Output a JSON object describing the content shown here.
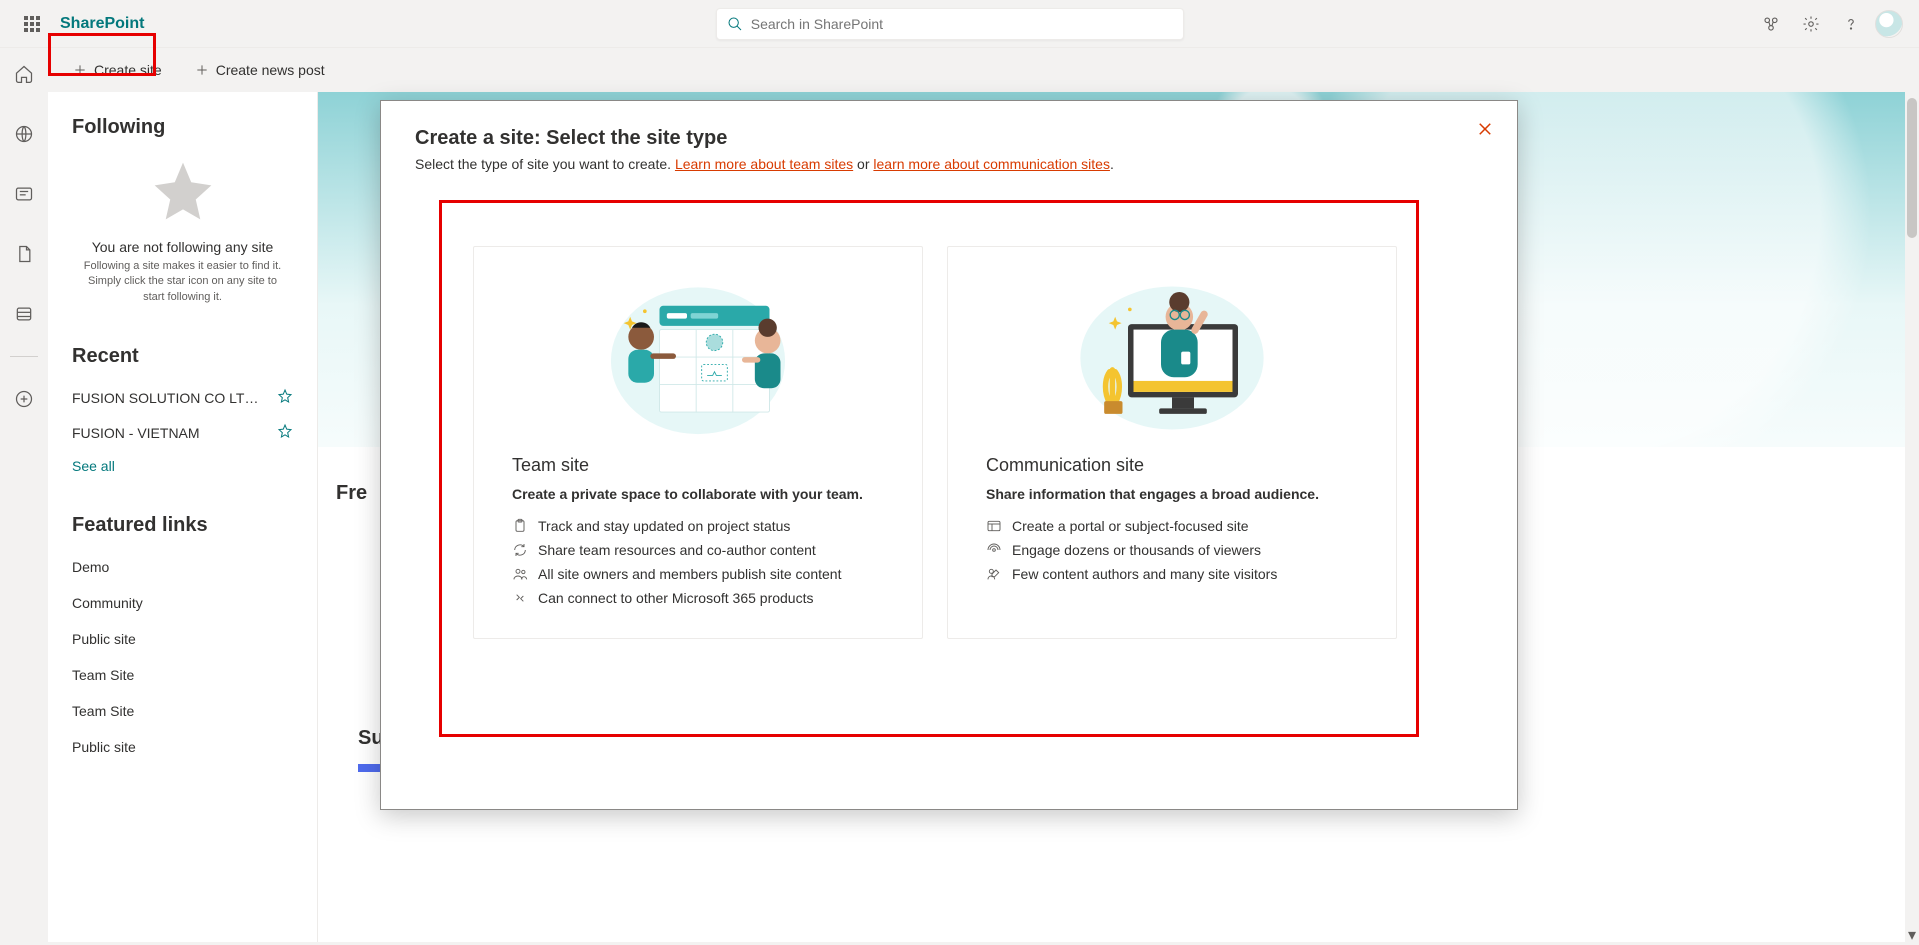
{
  "header": {
    "app_title": "SharePoint",
    "search_placeholder": "Search in SharePoint"
  },
  "command_bar": {
    "create_site": "Create site",
    "create_news_post": "Create news post"
  },
  "sidebar": {
    "following_title": "Following",
    "following_empty_1": "You are not following any site",
    "following_empty_2": "Following a site makes it easier to find it. Simply click the star icon on any site to start following it.",
    "recent_title": "Recent",
    "recent_items": [
      {
        "name": "FUSION SOLUTION CO LTD ..."
      },
      {
        "name": "FUSION - VIETNAM"
      }
    ],
    "see_all": "See all",
    "featured_title": "Featured links",
    "featured_links": [
      "Demo",
      "Community",
      "Public site",
      "Team Site",
      "Team Site",
      "Public site"
    ]
  },
  "main": {
    "frequent_label": "Fre",
    "suggested_title": "Suggested sites"
  },
  "modal": {
    "title": "Create a site: Select the site type",
    "subtitle_prefix": "Select the type of site you want to create. ",
    "learn_team": "Learn more about team sites",
    "subtitle_or": " or ",
    "learn_comm": "learn more about communication sites",
    "subtitle_suffix": ".",
    "team_card": {
      "title": "Team site",
      "tagline": "Create a private space to collaborate with your team.",
      "features": [
        "Track and stay updated on project status",
        "Share team resources and co-author content",
        "All site owners and members publish site content",
        "Can connect to other Microsoft 365 products"
      ]
    },
    "comm_card": {
      "title": "Communication site",
      "tagline": "Share information that engages a broad audience.",
      "features": [
        "Create a portal or subject-focused site",
        "Engage dozens or thousands of viewers",
        "Few content authors and many site visitors"
      ]
    }
  }
}
